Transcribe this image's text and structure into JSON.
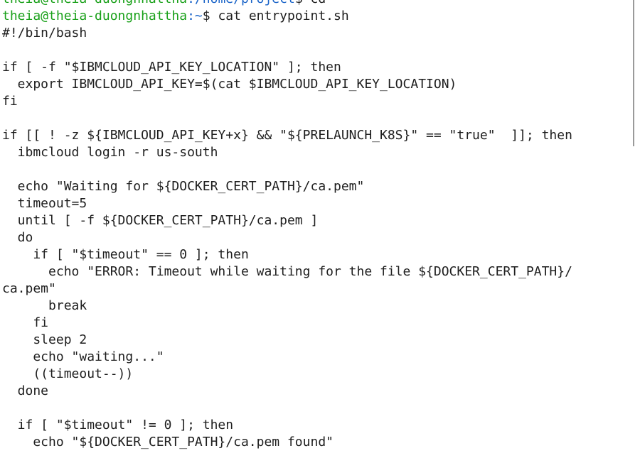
{
  "terminal": {
    "partial_prompt": {
      "user_host": "theia@theia-duongnhattha",
      "path": ":/home/project",
      "symbol": "$ ",
      "command": "cd"
    },
    "prompt": {
      "user_host": "theia@theia-duongnhattha",
      "path": ":~",
      "symbol": "$ ",
      "command": "cat entrypoint.sh"
    },
    "output_lines": [
      "#!/bin/bash",
      "",
      "if [ -f \"$IBMCLOUD_API_KEY_LOCATION\" ]; then",
      "  export IBMCLOUD_API_KEY=$(cat $IBMCLOUD_API_KEY_LOCATION)",
      "fi",
      "",
      "if [[ ! -z ${IBMCLOUD_API_KEY+x} && \"${PRELAUNCH_K8S}\" == \"true\"  ]]; then",
      "  ibmcloud login -r us-south",
      "",
      "  echo \"Waiting for ${DOCKER_CERT_PATH}/ca.pem\"",
      "  timeout=5",
      "  until [ -f ${DOCKER_CERT_PATH}/ca.pem ]",
      "  do",
      "    if [ \"$timeout\" == 0 ]; then",
      "      echo \"ERROR: Timeout while waiting for the file ${DOCKER_CERT_PATH}/",
      "ca.pem\"",
      "      break",
      "    fi",
      "    sleep 2",
      "    echo \"waiting...\"",
      "    ((timeout--))",
      "  done",
      "",
      "  if [ \"$timeout\" != 0 ]; then",
      "    echo \"${DOCKER_CERT_PATH}/ca.pem found\""
    ]
  }
}
